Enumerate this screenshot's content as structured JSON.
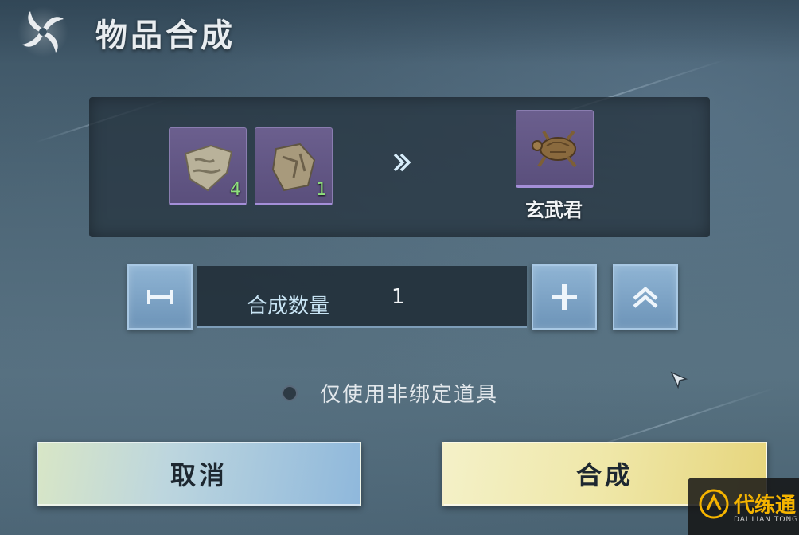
{
  "header": {
    "title": "物品合成"
  },
  "recipe": {
    "ingredients": [
      {
        "icon": "stone-fragment-icon",
        "count": "4"
      },
      {
        "icon": "rock-shard-icon",
        "count": "1"
      }
    ],
    "arrow_icon": "double-chevron-right-icon",
    "result": {
      "icon": "turtle-icon",
      "name": "玄武君"
    }
  },
  "quantity": {
    "label": "合成数量",
    "value": "1",
    "minus_icon": "minus-icon",
    "plus_icon": "plus-icon",
    "max_icon": "double-chevron-up-icon"
  },
  "option": {
    "label": "仅使用非绑定道具",
    "checked": false
  },
  "buttons": {
    "cancel": "取消",
    "combine": "合成"
  },
  "watermark": {
    "text": "代练通",
    "sub": "DAI LIAN TONG"
  },
  "colors": {
    "slot_purple": "#5a4f7c",
    "count_green": "#8fe07d",
    "cancel_blue": "#8fb8dc",
    "combine_gold": "#e6d57c",
    "watermark_orange": "#f5b400"
  }
}
